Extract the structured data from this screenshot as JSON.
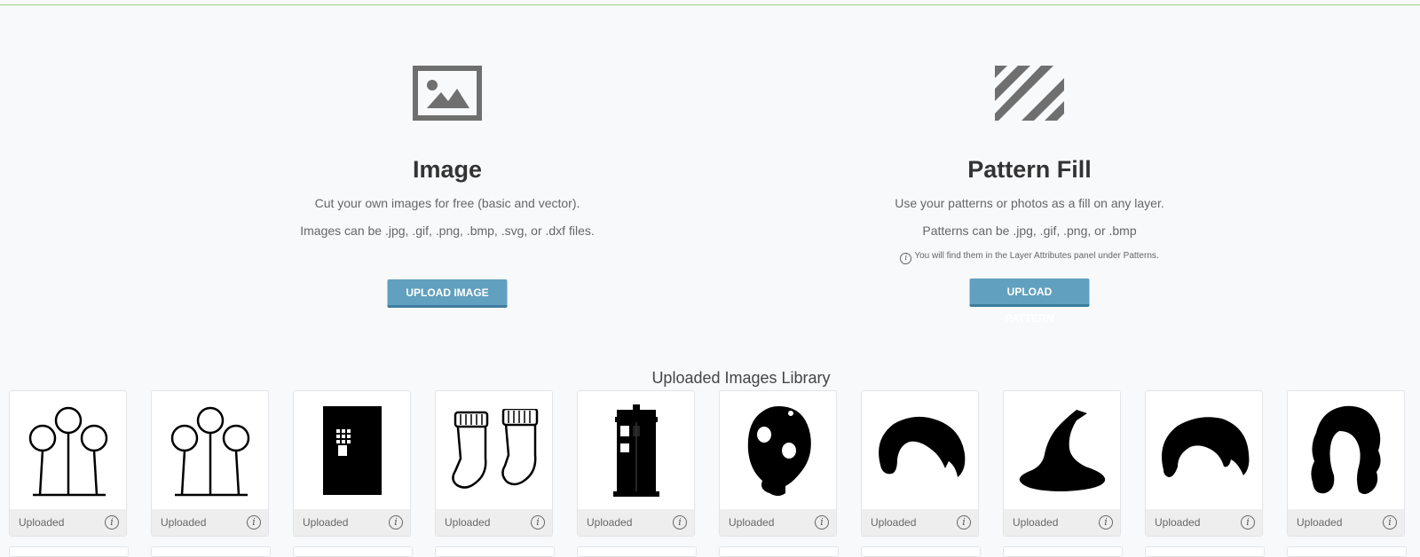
{
  "image_section": {
    "title": "Image",
    "desc1": "Cut your own images for free (basic and vector).",
    "desc2": "Images can be .jpg, .gif, .png, .bmp, .svg, or .dxf files.",
    "button": "UPLOAD IMAGE",
    "icon": "image-icon"
  },
  "pattern_section": {
    "title": "Pattern Fill",
    "desc1": "Use your patterns or photos as a fill on any layer.",
    "desc2": "Patterns can be .jpg, .gif, .png, or .bmp",
    "note": "You will find them in the Layer Attributes panel under Patterns.",
    "button": "UPLOAD PATTERN",
    "icon": "pattern-stripes-icon"
  },
  "library": {
    "title": "Uploaded Images Library",
    "items": [
      {
        "label": "Uploaded",
        "icon": "quidditch-hoops-icon"
      },
      {
        "label": "Uploaded",
        "icon": "quidditch-hoops-icon"
      },
      {
        "label": "Uploaded",
        "icon": "door-icon"
      },
      {
        "label": "Uploaded",
        "icon": "socks-icon"
      },
      {
        "label": "Uploaded",
        "icon": "police-box-icon"
      },
      {
        "label": "Uploaded",
        "icon": "gas-mask-icon"
      },
      {
        "label": "Uploaded",
        "icon": "hair-icon"
      },
      {
        "label": "Uploaded",
        "icon": "witch-hat-icon"
      },
      {
        "label": "Uploaded",
        "icon": "hair-short-icon"
      },
      {
        "label": "Uploaded",
        "icon": "hair-long-icon"
      }
    ]
  },
  "colors": {
    "accent_line": "#9fd17a",
    "button": "#62a0bf",
    "button_border": "#3d7d9f"
  }
}
